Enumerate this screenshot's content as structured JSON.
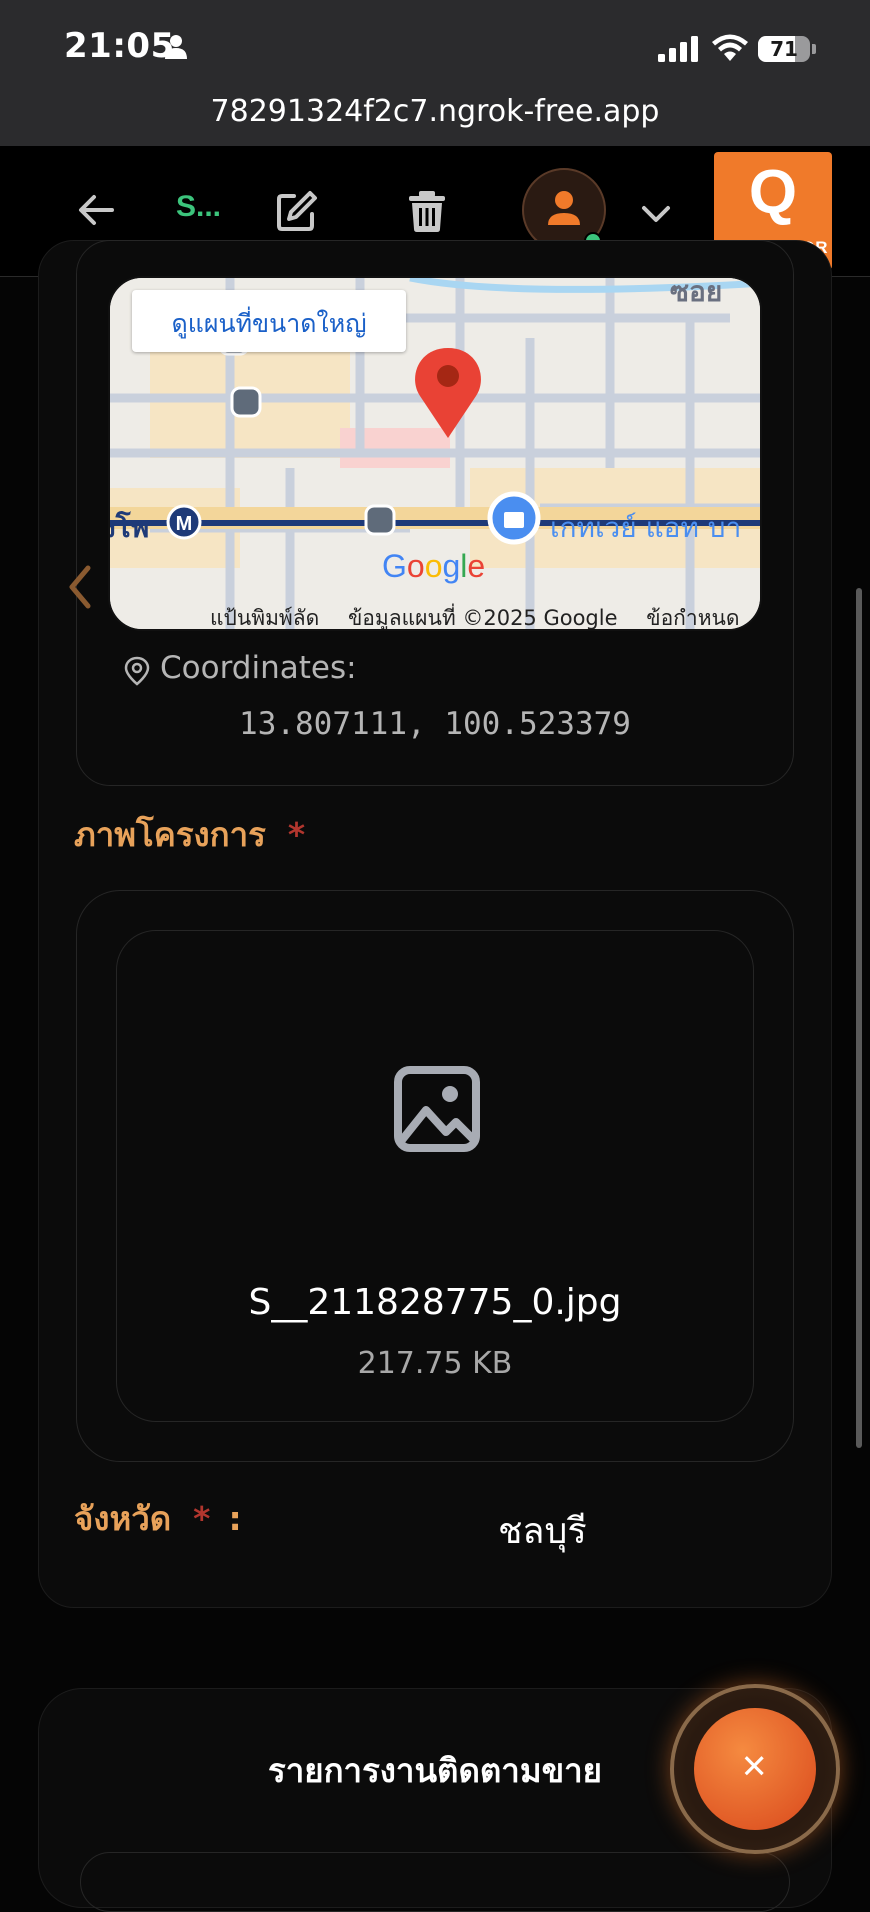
{
  "status_bar": {
    "time": "21:05",
    "battery": "71",
    "battery_level": 0.71
  },
  "browser": {
    "url": "78291324f2c7.ngrok-free.app"
  },
  "header": {
    "title": "S...",
    "logo_letter": "Q",
    "logo_text": "COLLECTOR",
    "accent": "#f07a2a"
  },
  "map": {
    "view_larger_label": "ดูแผนที่ขนาดใหญ่",
    "street_label": "ซอย",
    "station_label": "งโพ",
    "place_label": "เกทเวย์ แอท บา",
    "google_logo": "Google",
    "footer": [
      "แป้นพิมพ์ลัด",
      "ข้อมูลแผนที่ ©2025 Google",
      "ข้อกำหนด"
    ]
  },
  "location": {
    "coordinates_label": "Coordinates:",
    "coordinates_value": "13.807111, 100.523379"
  },
  "project_image": {
    "label": "ภาพโครงการ",
    "required_mark": "*",
    "file_name": "S__211828775_0.jpg",
    "file_size": "217.75 KB"
  },
  "province": {
    "label": "จังหวัด",
    "required_mark": "*",
    "colon": ":",
    "value": "ชลบุรี"
  },
  "followup": {
    "title": "รายการงานติดตามขาย"
  },
  "fab": {
    "symbol": "+"
  }
}
